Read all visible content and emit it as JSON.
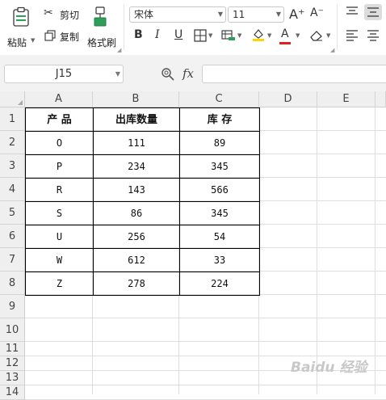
{
  "ribbon": {
    "paste_label": "粘贴",
    "cut_label": "剪切",
    "copy_label": "复制",
    "format_painter_label": "格式刷",
    "font_name": "宋体",
    "font_size": "11",
    "increase_font_glyph": "A⁺",
    "decrease_font_glyph": "A⁻",
    "bold_glyph": "B",
    "italic_glyph": "I",
    "underline_glyph": "U",
    "font_color_glyph": "A",
    "font_color": "#e02020",
    "fill_color": "#ffd400"
  },
  "formula_bar": {
    "name_box": "J15",
    "fx_label": "fx",
    "formula": ""
  },
  "sheet": {
    "columns": [
      "A",
      "B",
      "C",
      "D",
      "E"
    ],
    "rows": [
      "1",
      "2",
      "3",
      "4",
      "5",
      "6",
      "7",
      "8",
      "9",
      "10",
      "11",
      "12",
      "13",
      "14"
    ],
    "table": [
      [
        "产 品",
        "出库数量",
        "库 存"
      ],
      [
        "O",
        "111",
        "89"
      ],
      [
        "P",
        "234",
        "345"
      ],
      [
        "R",
        "143",
        "566"
      ],
      [
        "S",
        "86",
        "345"
      ],
      [
        "U",
        "256",
        "54"
      ],
      [
        "W",
        "612",
        "33"
      ],
      [
        "Z",
        "278",
        "224"
      ]
    ]
  },
  "watermark": "Baidu 经验"
}
